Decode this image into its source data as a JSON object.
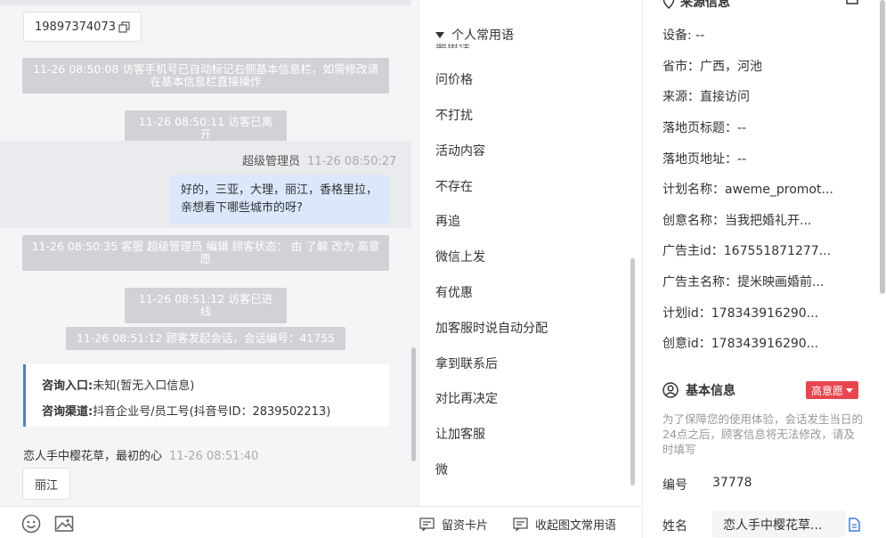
{
  "chat": {
    "phone": "19897374073",
    "sys1": "11-26 08:50:08 访客手机号已自动标记右侧基本信息栏，如需修改请在基本信息栏直接操作",
    "sys2": "11-26 08:50:11 访客已离开",
    "agent_name": "超级管理员",
    "agent_ts": "11-26 08:50:27",
    "agent_msg": "好的，三亚，大理，丽江，香格里拉，亲想看下哪些城市的呀?",
    "sys3": "11-26 08:50:35 客服 超级管理员 编辑 顾客状态： 由 了解 改为 高意愿",
    "sys4": "11-26 08:51:12 访客已进线",
    "sys5": "11-26 08:51:12 顾客发起会话，会话编号：41755",
    "entry_label": "咨询入口:",
    "entry_value": "未知(暂无入口信息)",
    "channel_label": "咨询渠道:",
    "channel_value": "抖音企业号/员工号(抖音号ID：2839502213)",
    "visitor_name": "恋人手中樱花草，最初的心",
    "visitor_ts": "11-26 08:51:40",
    "visitor_msg": "丽江"
  },
  "toolbar": {
    "emoji_icon": "smile-icon",
    "image_icon": "image-icon",
    "card_label": "留资卡片",
    "fold_label": "收起图文常用语"
  },
  "phrases": {
    "header": "个人常用语",
    "cut_item": "要电话",
    "items": [
      "问价格",
      "不打扰",
      "活动内容",
      "不存在",
      "再追",
      "微信上发",
      "有优惠",
      "加客服时说自动分配",
      "拿到联系后",
      "对比再决定",
      "让加客服",
      "微"
    ]
  },
  "side": {
    "source_title": "来源信息",
    "device": "设备: --",
    "region": "省市：广西，河池",
    "source": "来源：直接访问",
    "landing_title": "落地页标题：--",
    "landing_url": "落地页地址：--",
    "plan_name": "计划名称：aweme_promot...",
    "creative_name": "创意名称：当我把婚礼开...",
    "advertiser_id": "广告主id：167551871277...",
    "advertiser_name": "广告主名称：提米映画婚前...",
    "plan_id": "计划id：178343916290...",
    "creative_id": "创意id：178343916290...",
    "basic_title": "基本信息",
    "intent_badge": "高意愿",
    "notice": "为了保障您的使用体验，会话发生当日的24点之后，顾客信息将无法修改，请及时填写",
    "number_label": "编号",
    "number_value": "37778",
    "name_label": "姓名",
    "name_value": "恋人手中樱花草..."
  }
}
